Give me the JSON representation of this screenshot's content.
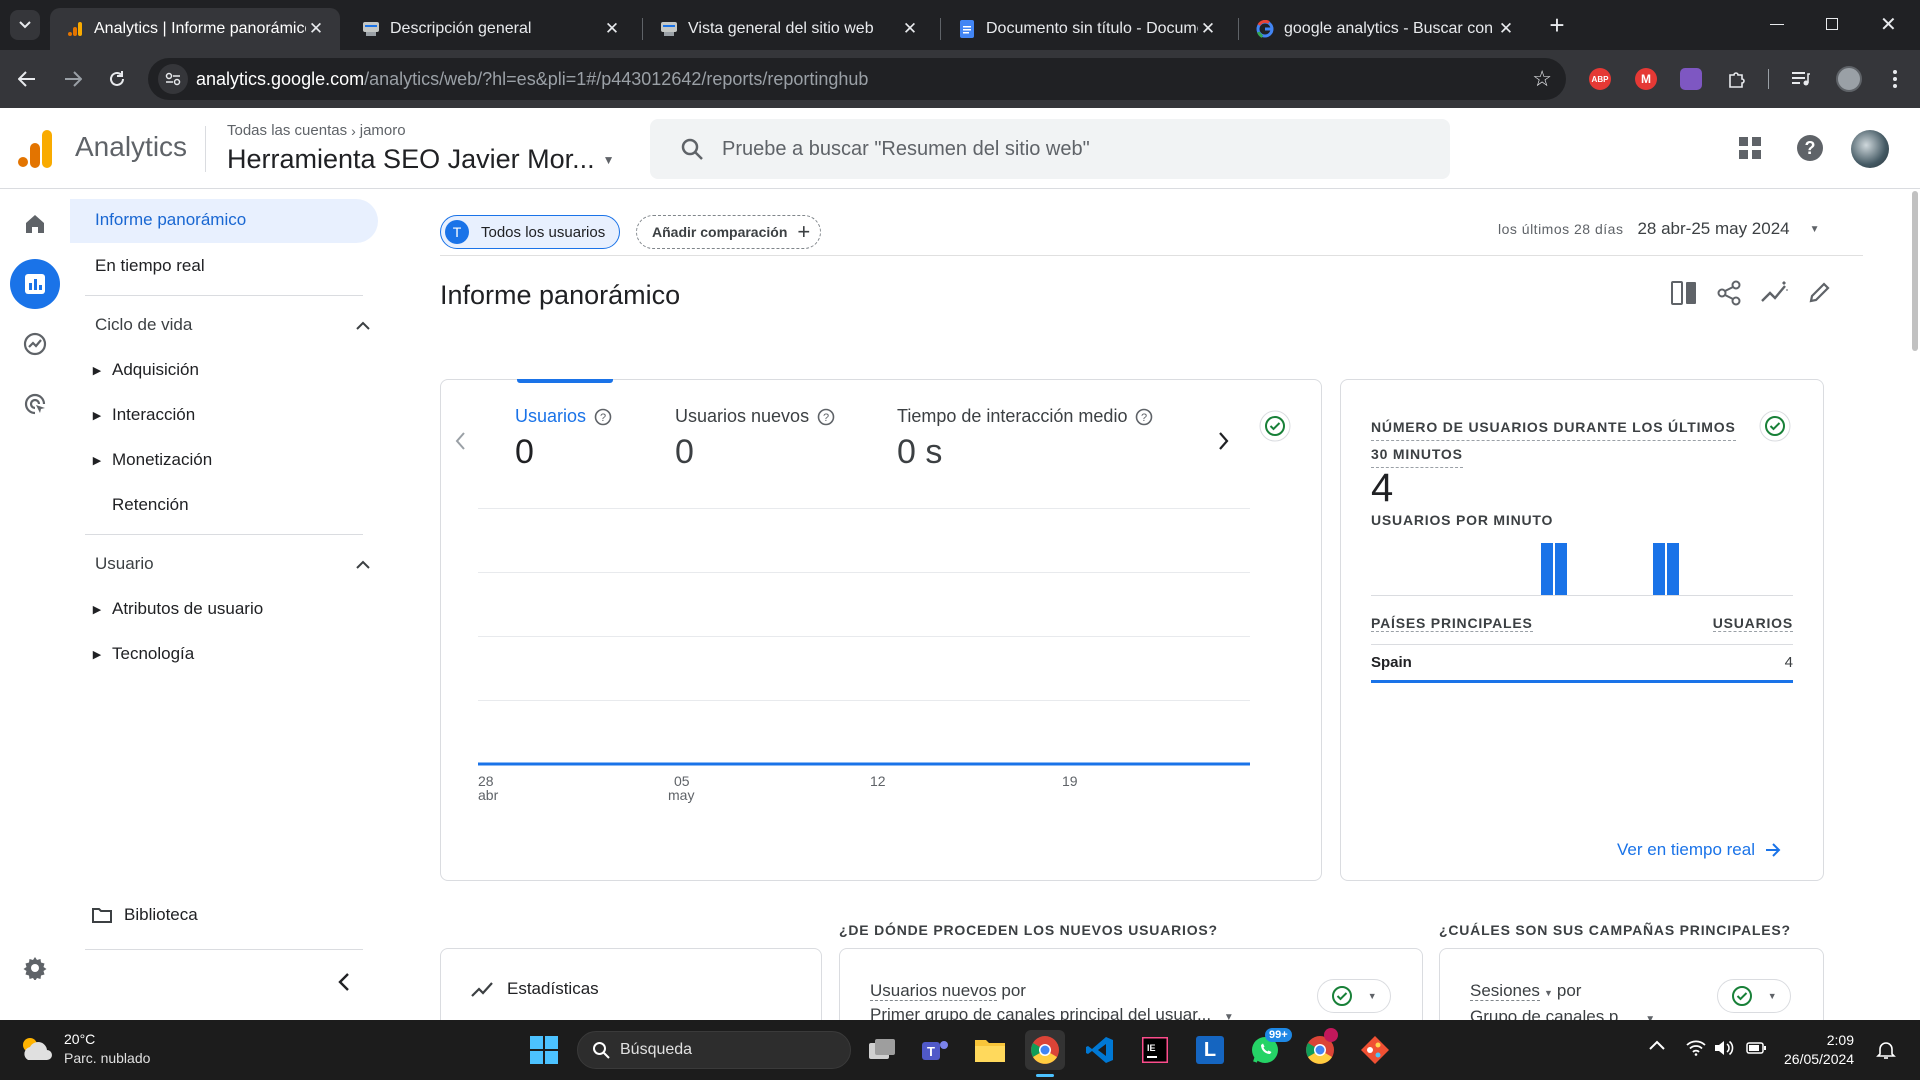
{
  "browser": {
    "tabs": [
      {
        "title": "Analytics | Informe panorámico",
        "icon": "analytics-icon",
        "active": true
      },
      {
        "title": "Descripción general",
        "icon": "search-console-icon",
        "active": false
      },
      {
        "title": "Vista general del sitio web",
        "icon": "search-console-icon",
        "active": false
      },
      {
        "title": "Documento sin título - Documentos",
        "icon": "docs-icon",
        "active": false
      },
      {
        "title": "google analytics - Buscar con Google",
        "icon": "google-icon",
        "active": false
      }
    ],
    "url_domain": "analytics.google.com",
    "url_rest": "/analytics/web/?hl=es&pli=1#/p443012642/reports/reportinghub",
    "extensions": [
      "ABP",
      "M"
    ]
  },
  "header": {
    "product": "Analytics",
    "breadcrumb_root": "Todas las cuentas",
    "breadcrumb_account": "jamoro",
    "property": "Herramienta SEO Javier Mor...",
    "search_placeholder": "Pruebe a buscar \"Resumen del sitio web\""
  },
  "sidenav": {
    "top_items": [
      "Informe panorámico",
      "En tiempo real"
    ],
    "sections": [
      {
        "title": "Ciclo de vida",
        "items": [
          {
            "label": "Adquisición",
            "expandable": true
          },
          {
            "label": "Interacción",
            "expandable": true
          },
          {
            "label": "Monetización",
            "expandable": true
          },
          {
            "label": "Retención",
            "expandable": false
          }
        ]
      },
      {
        "title": "Usuario",
        "items": [
          {
            "label": "Atributos de usuario",
            "expandable": true
          },
          {
            "label": "Tecnología",
            "expandable": true
          }
        ]
      }
    ],
    "library": "Biblioteca"
  },
  "main": {
    "comparison_chip": {
      "avatar": "T",
      "label": "Todos los usuarios"
    },
    "add_comparison": "Añadir comparación",
    "date_prefix": "los últimos 28 días",
    "date_range": "28 abr-25 may 2024",
    "title": "Informe panorámico",
    "metrics": [
      {
        "label": "Usuarios",
        "value": "0",
        "selected": true
      },
      {
        "label": "Usuarios nuevos",
        "value": "0",
        "selected": false
      },
      {
        "label": "Tiempo de interacción medio",
        "value": "0 s",
        "selected": false
      }
    ],
    "x_ticks": [
      {
        "day": "28",
        "month": "abr"
      },
      {
        "day": "05",
        "month": "may"
      },
      {
        "day": "12",
        "month": ""
      },
      {
        "day": "19",
        "month": ""
      }
    ]
  },
  "chart_data": {
    "type": "line",
    "title": "",
    "x_ticks": [
      "28 abr",
      "05 may",
      "12",
      "19"
    ],
    "series": [
      {
        "values": [
          0,
          0,
          0,
          0,
          0,
          0,
          0,
          0,
          0,
          0,
          0,
          0,
          0,
          0,
          0,
          0,
          0,
          0,
          0,
          0,
          0,
          0,
          0,
          0,
          0,
          0,
          0,
          0
        ]
      }
    ],
    "color": "#1a73e8",
    "grid": true
  },
  "realtime": {
    "title_line1": "NÚMERO DE USUARIOS DURANTE LOS ÚLTIMOS",
    "title_line2": "30 MINUTOS",
    "count": "4",
    "per_minute_label": "USUARIOS POR MINUTO",
    "per_minute_bars": [
      0,
      0,
      0,
      0,
      0,
      0,
      0,
      0,
      0,
      0,
      0,
      0,
      1,
      1,
      0,
      0,
      0,
      0,
      0,
      0,
      1,
      1,
      0,
      0,
      0,
      0,
      0,
      0,
      0,
      0
    ],
    "countries_header": "PAÍSES PRINCIPALES",
    "users_header": "USUARIOS",
    "country": "Spain",
    "country_users": "4",
    "link": "Ver en tiempo real"
  },
  "bottom": {
    "q1": "¿DE DÓNDE PROCEDEN LOS NUEVOS USUARIOS?",
    "q2": "¿CUÁLES SON SUS CAMPAÑAS PRINCIPALES?",
    "stats_title": "Estadísticas",
    "card2_line1a": "Usuarios nuevos",
    "card2_line1b": "por",
    "card2_line2": "Primer grupo de canales principal del usuar...",
    "card3_line1a": "Sesiones",
    "card3_line1b": "por",
    "card3_line2": "Grupo de canales p..."
  },
  "taskbar": {
    "weather_temp": "20°C",
    "weather_desc": "Parc. nublado",
    "search_label": "Búsqueda",
    "whatsapp_badge": "99+",
    "time": "2:09",
    "date": "26/05/2024"
  },
  "colors": {
    "accent": "#1a73e8",
    "nav_selected": "#e8f0fe",
    "success": "#188038"
  }
}
